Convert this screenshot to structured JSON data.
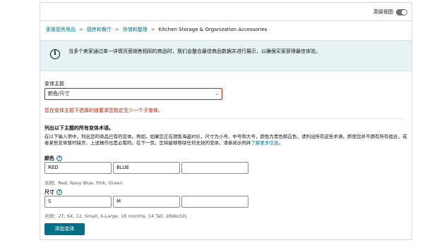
{
  "header": {
    "advanced_view_label": "高级视图"
  },
  "breadcrumb": [
    {
      "label": "家居厨房用品",
      "link": true
    },
    {
      "label": "厨房和餐厅",
      "link": true
    },
    {
      "label": "存储和整理",
      "link": true
    },
    {
      "label": "Kitchen Storage & Organization Accessories",
      "link": false
    }
  ],
  "breadcrumb_separator": ">",
  "info_box": {
    "text": "当多个卖家通过单一详情页面销售相同的商品时，我们会整合最佳商品数据并进行展示，以确保买家获得最佳体验。"
  },
  "variation_theme": {
    "label": "变体主题",
    "selected": "颜色/尺寸",
    "error": "您在变体主题下选择的值要求您指定至少一个子变体。"
  },
  "variations": {
    "title": "列出以下主题的所有变体术语。",
    "description": "在以下输入项中，列出您的商品已有的变体。例如，如果您正在销售海盗衬衫，尺寸为小号、中号和大号，颜色为黑色和白色，请列出所有这些术语。即使您并不拥有所有组合，或者某些变体暂时缺货，上述操作也是必需的。在下一页，您将能够移除任何无效的变体。请参阅示例并",
    "learn_more": "了解更多信息",
    "color": {
      "label": "颜色",
      "values": [
        "RED",
        "BLUE",
        ""
      ],
      "example": "示例：Red, Navy Blue, Pink, Green"
    },
    "size": {
      "label": "尺寸",
      "values": [
        "S",
        "M",
        ""
      ],
      "example": "示例：2T, 6X, 12, Small, X-Large, 18 months, 14 Tall, 28Wx32L"
    },
    "add_button": "添加变体"
  },
  "colors": {
    "link": "#007185",
    "error": "#b12704",
    "info_bg": "#e6f3f2",
    "button": "#007185"
  },
  "icons": [
    "info-icon",
    "help-icon",
    "chevron-down-icon",
    "toggle-switch"
  ]
}
